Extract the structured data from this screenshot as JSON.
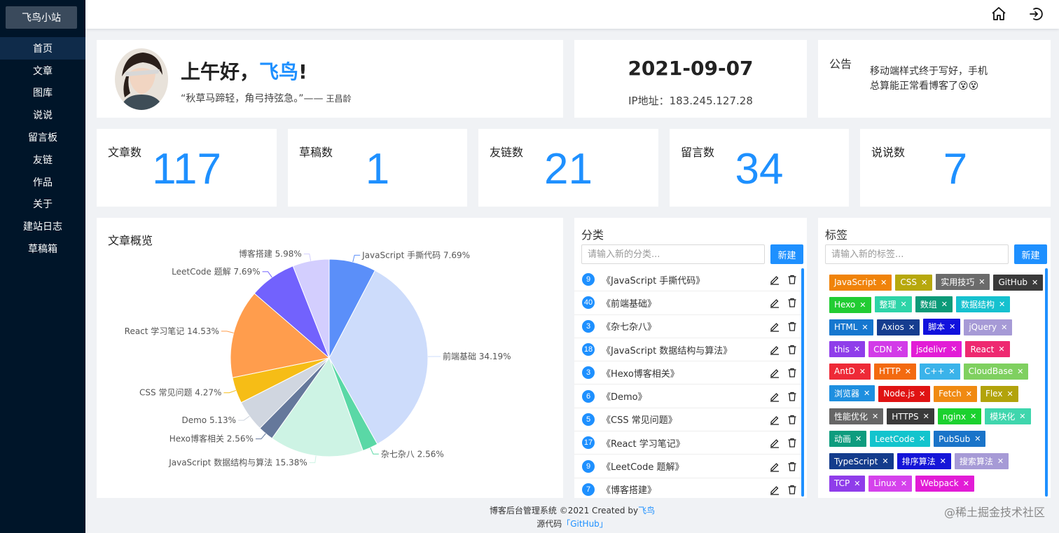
{
  "sidebar": {
    "logo": "飞鸟小站",
    "items": [
      {
        "label": "首页",
        "active": true
      },
      {
        "label": "文章"
      },
      {
        "label": "图库"
      },
      {
        "label": "说说"
      },
      {
        "label": "留言板"
      },
      {
        "label": "友链"
      },
      {
        "label": "作品"
      },
      {
        "label": "关于"
      },
      {
        "label": "建站日志"
      },
      {
        "label": "草稿箱"
      }
    ]
  },
  "header": {
    "icons": [
      "home-icon",
      "logout-icon"
    ]
  },
  "welcome": {
    "greeting_prefix": "上午好，",
    "name": "飞鸟",
    "greeting_suffix": "!",
    "quote": "“秋草马蹄轻，角弓持弦急。”——",
    "author": "王昌龄"
  },
  "info": {
    "date": "2021-09-07",
    "ip": "IP地址：183.245.127.28"
  },
  "notice": {
    "label": "公告",
    "text": "移动端样式终于写好，手机总算能正常看博客了😵😵"
  },
  "stats": [
    {
      "label": "文章数",
      "value": "117"
    },
    {
      "label": "草稿数",
      "value": "1"
    },
    {
      "label": "友链数",
      "value": "21"
    },
    {
      "label": "留言数",
      "value": "34"
    },
    {
      "label": "说说数",
      "value": "7"
    }
  ],
  "chart_title": "文章概览",
  "chart_data": {
    "type": "pie",
    "title": "文章概览",
    "slices": [
      {
        "label": "JavaScript 手撕代码 7.69%",
        "value": 7.69,
        "color": "#5b8ff9"
      },
      {
        "label": "前端基础 34.19%",
        "value": 34.19,
        "color": "#cddcfb"
      },
      {
        "label": "杂七杂八 2.56%",
        "value": 2.56,
        "color": "#5ad8a6"
      },
      {
        "label": "JavaScript 数据结构与算法 15.38%",
        "value": 15.38,
        "color": "#cdf3e4"
      },
      {
        "label": "Hexo博客相关 2.56%",
        "value": 2.56,
        "color": "#65789b"
      },
      {
        "label": "Demo 5.13%",
        "value": 5.13,
        "color": "#d0d6e0"
      },
      {
        "label": "CSS 常见问题 4.27%",
        "value": 4.27,
        "color": "#f6bd16"
      },
      {
        "label": "React 学习笔记 14.53%",
        "value": 14.53,
        "color": "#ff9d4d"
      },
      {
        "label": "LeetCode 题解 7.69%",
        "value": 7.69,
        "color": "#7262fd"
      },
      {
        "label": "博客搭建 5.98%",
        "value": 5.98,
        "color": "#d3cefe"
      }
    ]
  },
  "category": {
    "title": "分类",
    "placeholder": "请输入新的分类...",
    "button": "新建",
    "items": [
      {
        "count": "9",
        "name": "《JavaScript 手撕代码》"
      },
      {
        "count": "40",
        "name": "《前端基础》"
      },
      {
        "count": "3",
        "name": "《杂七杂八》"
      },
      {
        "count": "18",
        "name": "《JavaScript 数据结构与算法》"
      },
      {
        "count": "3",
        "name": "《Hexo博客相关》"
      },
      {
        "count": "6",
        "name": "《Demo》"
      },
      {
        "count": "5",
        "name": "《CSS 常见问题》"
      },
      {
        "count": "17",
        "name": "《React 学习笔记》"
      },
      {
        "count": "9",
        "name": "《LeetCode 题解》"
      },
      {
        "count": "7",
        "name": "《博客搭建》"
      }
    ]
  },
  "tags": {
    "title": "标签",
    "placeholder": "请输入新的标签...",
    "button": "新建",
    "close_glyph": "✕",
    "items": [
      {
        "label": "JavaScript",
        "color": "#f0830a"
      },
      {
        "label": "CSS",
        "color": "#b7a80d"
      },
      {
        "label": "实用技巧",
        "color": "#6b6b6b"
      },
      {
        "label": "GitHub",
        "color": "#3a3a3a"
      },
      {
        "label": "Hexo",
        "color": "#22cc33"
      },
      {
        "label": "整理",
        "color": "#2ed4a8"
      },
      {
        "label": "数组",
        "color": "#0b9a78"
      },
      {
        "label": "数据结构",
        "color": "#15c1cf"
      },
      {
        "label": "HTML",
        "color": "#1677cf"
      },
      {
        "label": "Axios",
        "color": "#163d8f"
      },
      {
        "label": "脚本",
        "color": "#1111dd"
      },
      {
        "label": "jQuery",
        "color": "#a69ad6"
      },
      {
        "label": "this",
        "color": "#8f3dea"
      },
      {
        "label": "CDN",
        "color": "#d23be8"
      },
      {
        "label": "jsdelivr",
        "color": "#e21cd6"
      },
      {
        "label": "React",
        "color": "#ee2970"
      },
      {
        "label": "AntD",
        "color": "#ee2a37"
      },
      {
        "label": "HTTP",
        "color": "#f36a10"
      },
      {
        "label": "C++",
        "color": "#3ab3ea"
      },
      {
        "label": "CloudBase",
        "color": "#7fd060"
      },
      {
        "label": "浏览器",
        "color": "#1e8fe0"
      },
      {
        "label": "Node.js",
        "color": "#e01313"
      },
      {
        "label": "Fetch",
        "color": "#f08a12"
      },
      {
        "label": "Flex",
        "color": "#b2a30b"
      },
      {
        "label": "性能优化",
        "color": "#666666"
      },
      {
        "label": "HTTPS",
        "color": "#3a3a3a"
      },
      {
        "label": "nginx",
        "color": "#1bd12e"
      },
      {
        "label": "模块化",
        "color": "#3fd6ad"
      },
      {
        "label": "动画",
        "color": "#0e9c7e"
      },
      {
        "label": "LeetCode",
        "color": "#13c4cd"
      },
      {
        "label": "PubSub",
        "color": "#1a74c9"
      },
      {
        "label": "TypeScript",
        "color": "#143c8c"
      },
      {
        "label": "排序算法",
        "color": "#1515d8"
      },
      {
        "label": "搜索算法",
        "color": "#a69ad6"
      },
      {
        "label": "TCP",
        "color": "#8f3dea"
      },
      {
        "label": "Linux",
        "color": "#d542ec"
      },
      {
        "label": "Webpack",
        "color": "#e21cd6"
      }
    ]
  },
  "footer": {
    "line1": "博客后台管理系统 ©2021 Created by",
    "author": "飞鸟",
    "line2": "源代码",
    "repo": "「GitHub」"
  },
  "watermark": "@稀土掘金技术社区"
}
